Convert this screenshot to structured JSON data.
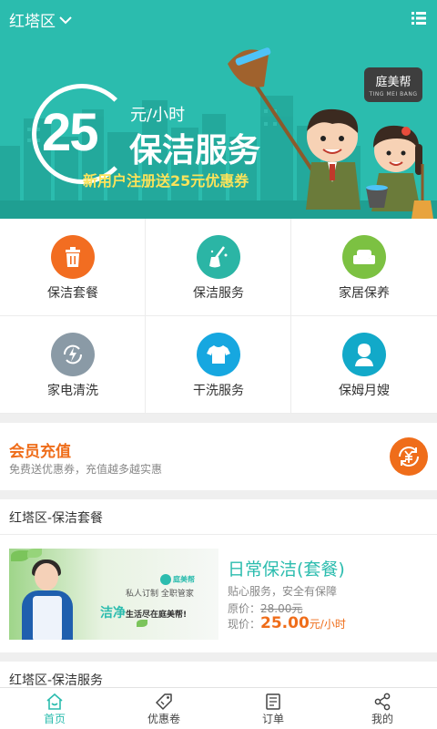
{
  "header": {
    "city": "红塔区",
    "menu_icon": "list-icon"
  },
  "banner": {
    "price": "25",
    "unit": "元/小时",
    "headline": "保洁服务",
    "promo": "新用户注册送25元优惠券",
    "brand": "庭美帮",
    "brand_sub": "TING MEI BANG",
    "color": "#2bbcae"
  },
  "services": [
    {
      "label": "保洁套餐",
      "icon": "trash-icon",
      "color": "#f26d21"
    },
    {
      "label": "保洁服务",
      "icon": "broom-icon",
      "color": "#2bb5a5"
    },
    {
      "label": "家居保养",
      "icon": "sofa-icon",
      "color": "#7cc142"
    },
    {
      "label": "家电清洗",
      "icon": "lightning-refresh-icon",
      "color": "#8a9aa6"
    },
    {
      "label": "干洗服务",
      "icon": "tshirt-icon",
      "color": "#16a7e0"
    },
    {
      "label": "保姆月嫂",
      "icon": "nanny-icon",
      "color": "#12a9c9"
    }
  ],
  "member": {
    "title": "会员充值",
    "subtitle": "免费送优惠券，充值越多越实惠",
    "icon": "yen-refresh-icon",
    "color": "#ef6d1a"
  },
  "package_section": {
    "header": "红塔区-保洁套餐",
    "item": {
      "title": "日常保洁(套餐)",
      "desc": "贴心服务，安全有保障",
      "original_label": "原价：",
      "original_price": "28.00元",
      "current_label": "现价：",
      "current_price": "25.00",
      "current_unit": "元/小时",
      "thumb_brand": "庭美帮",
      "thumb_tag1": "私人订制 全职管家",
      "thumb_tag2_em": "洁净",
      "thumb_tag2": "生活尽在庭美帮!"
    }
  },
  "service_section": {
    "header": "红塔区-保洁服务"
  },
  "tabbar": {
    "tabs": [
      {
        "label": "首页",
        "icon": "home-icon",
        "active": true
      },
      {
        "label": "优惠卷",
        "icon": "coupon-tag-icon",
        "active": false
      },
      {
        "label": "订单",
        "icon": "order-list-icon",
        "active": false
      },
      {
        "label": "我的",
        "icon": "share-profile-icon",
        "active": false
      }
    ],
    "active_color": "#2bbcae"
  }
}
